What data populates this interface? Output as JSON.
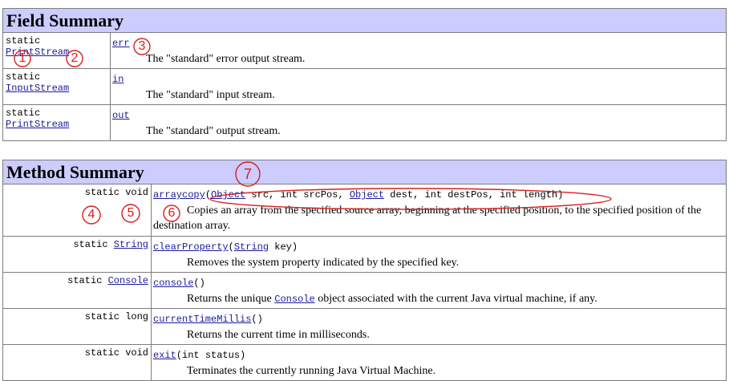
{
  "field_summary": {
    "title": "Field Summary",
    "rows": [
      {
        "modifier": "static",
        "type": "PrintStream",
        "name": "err",
        "desc": "The \"standard\" error output stream."
      },
      {
        "modifier": "static",
        "type": "InputStream",
        "name": "in",
        "desc": "The \"standard\" input stream."
      },
      {
        "modifier": "static",
        "type": "PrintStream",
        "name": "out",
        "desc": "The \"standard\" output stream."
      }
    ]
  },
  "method_summary": {
    "title": "Method Summary",
    "rows": [
      {
        "modifier": "static void",
        "name": "arraycopy",
        "params_open": "(",
        "p1_type": "Object",
        "p1_rest": " src, int srcPos, ",
        "p2_type": "Object",
        "p2_rest": " dest, int destPos, int length)",
        "desc": "Copies an array from the specified source array, beginning at the specified position, to the specified position of the destination array."
      },
      {
        "modifier_prefix": "static ",
        "modifier_type": "String",
        "name": "clearProperty",
        "params_open": "(",
        "p1_type": "String",
        "p1_rest": " key)",
        "desc": "Removes the system property indicated by the specified key."
      },
      {
        "modifier_prefix": "static ",
        "modifier_type": "Console",
        "name": "console",
        "params": "()",
        "desc_pre": "Returns the unique ",
        "desc_link": "Console",
        "desc_post": " object associated with the current Java virtual machine, if any."
      },
      {
        "modifier": "static long",
        "name": "currentTimeMillis",
        "params": "()",
        "desc": "Returns the current time in milliseconds."
      },
      {
        "modifier": "static void",
        "name": "exit",
        "params": "(int status)",
        "desc": "Terminates the currently running Java Virtual Machine."
      }
    ]
  },
  "annotations": [
    "1",
    "2",
    "3",
    "4",
    "5",
    "6",
    "7"
  ],
  "colors": {
    "header_bg": "#ccccff",
    "link": "#1a1a9a",
    "annotation": "#d81e1e"
  }
}
